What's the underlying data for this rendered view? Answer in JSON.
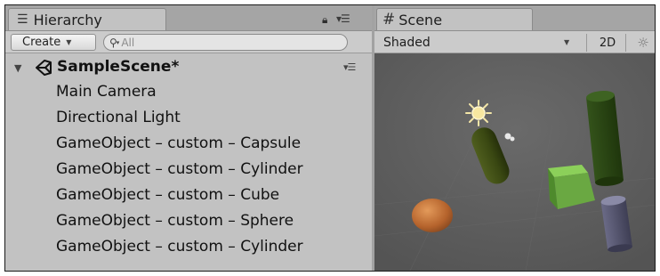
{
  "hierarchy": {
    "tab_label": "Hierarchy",
    "create_label": "Create",
    "search_placeholder": "All",
    "scene_name": "SampleScene*",
    "items": [
      "Main Camera",
      "Directional Light",
      "GameObject – custom – Capsule",
      "GameObject – custom – Cylinder",
      "GameObject – custom – Cube",
      "GameObject – custom – Sphere",
      "GameObject – custom – Cylinder"
    ]
  },
  "scene": {
    "tab_label": "Scene",
    "shading_mode": "Shaded",
    "mode_2d_label": "2D",
    "icons": [
      "hash-icon",
      "light-toggle-icon",
      "sun-gizmo-icon"
    ]
  },
  "colors": {
    "panel_bg": "#c2c2c2",
    "viewport_bg": "#5c5c5c",
    "capsule": "#3c4a14",
    "cylinder_tall": "#2b4312",
    "cube": "#72b445",
    "sphere": "#c8783c",
    "cylinder_small": "#505068"
  }
}
